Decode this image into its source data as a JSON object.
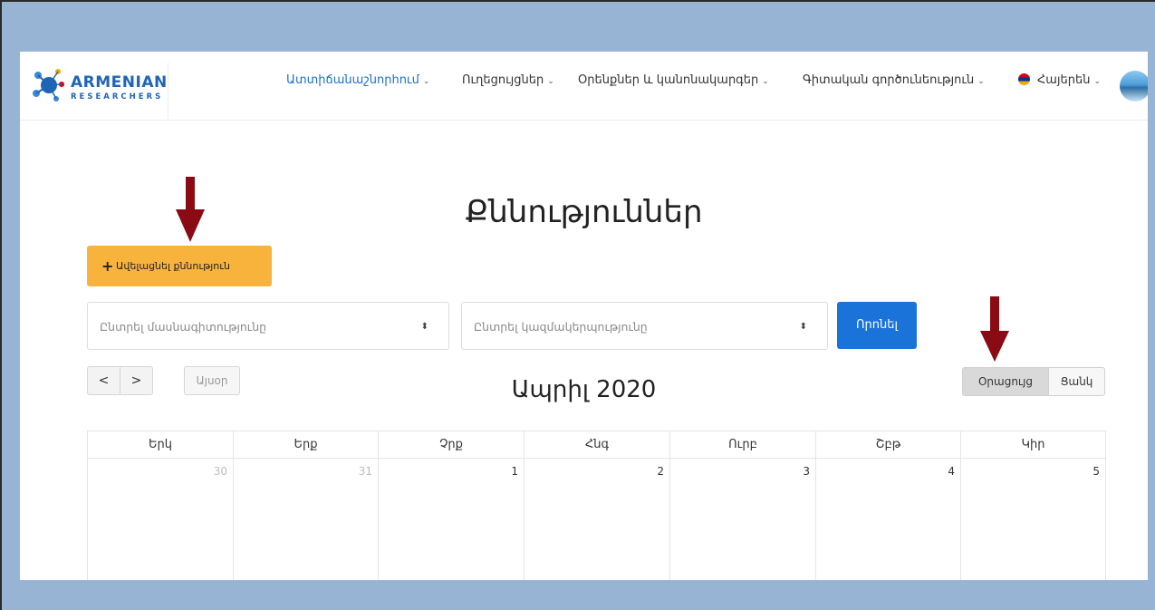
{
  "logo": {
    "title": "ARMENIAN",
    "subtitle": "RESEARCHERS"
  },
  "nav": {
    "items": [
      {
        "label": "Ատտիճանաշնորհում",
        "active": true
      },
      {
        "label": "Ուղեցույցներ",
        "active": false
      },
      {
        "label": "Օրենքներ և կանոնակարգեր",
        "active": false
      },
      {
        "label": "Գիտական գործունեություն",
        "active": false
      }
    ],
    "language": "Հայերեն",
    "caret": "⌄"
  },
  "page": {
    "title": "Քննություններ",
    "add_button": "Ավելացնել քննություն",
    "add_icon": "+"
  },
  "filters": {
    "specialty_placeholder": "Ընտրել մասնագիտությունը",
    "organization_placeholder": "Ընտրել կազմակերպությունը",
    "search_button": "Որոնել"
  },
  "calendar_toolbar": {
    "prev": "<",
    "next": ">",
    "today": "Այսօր",
    "month_title": "Ապրիլ 2020",
    "view_calendar": "Օրացույց",
    "view_list": "Ցանկ"
  },
  "calendar": {
    "weekdays": [
      "Երկ",
      "Երք",
      "Չրք",
      "Հնգ",
      "Ուրբ",
      "Շբթ",
      "Կիր"
    ],
    "days": [
      {
        "num": "30",
        "other_month": true
      },
      {
        "num": "31",
        "other_month": true
      },
      {
        "num": "1",
        "other_month": false
      },
      {
        "num": "2",
        "other_month": false
      },
      {
        "num": "3",
        "other_month": false
      },
      {
        "num": "4",
        "other_month": false
      },
      {
        "num": "5",
        "other_month": false
      }
    ]
  },
  "colors": {
    "frame": "#98b4d4",
    "accent_blue": "#1a73d9",
    "add_button": "#f8b33c",
    "arrow": "#8b0b14"
  }
}
